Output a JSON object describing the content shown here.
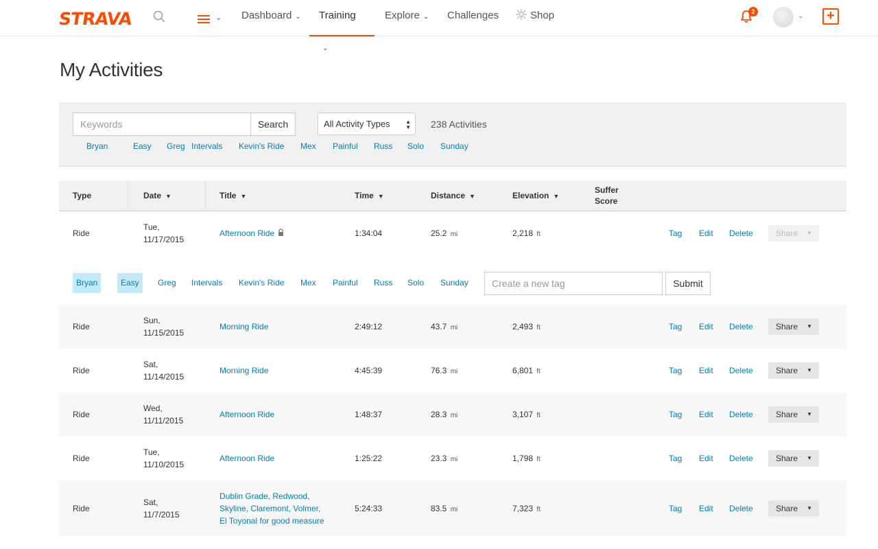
{
  "nav": {
    "logo": "STRAVA",
    "items": [
      {
        "label": "Dashboard",
        "has_menu": true
      },
      {
        "label": "Training",
        "has_menu": true,
        "active": true
      },
      {
        "label": "Explore",
        "has_menu": true
      },
      {
        "label": "Challenges",
        "has_menu": false
      },
      {
        "label": "Shop",
        "has_menu": false
      }
    ],
    "notification_count": "2",
    "accent_color": "#fc4c02",
    "icons": [
      "search-icon",
      "menu-icon",
      "shop-icon",
      "bell-icon",
      "avatar",
      "add-icon"
    ]
  },
  "page": {
    "title": "My Activities"
  },
  "filters": {
    "keyword_placeholder": "Keywords",
    "search_label": "Search",
    "activity_type": "All Activity Types",
    "count": "238 Activities",
    "tags": [
      "Bryan",
      "Easy",
      "Greg",
      "Intervals",
      "Kevin's Ride",
      "Mex",
      "Painful",
      "Russ",
      "Solo",
      "Sunday"
    ]
  },
  "table": {
    "columns": [
      {
        "label": "Type",
        "sortable": false
      },
      {
        "label": "Date",
        "sortable": true
      },
      {
        "label": "Title",
        "sortable": true
      },
      {
        "label": "Time",
        "sortable": true
      },
      {
        "label": "Distance",
        "sortable": true
      },
      {
        "label": "Elevation",
        "sortable": true
      },
      {
        "label": "Suffer Score",
        "sortable": false
      }
    ],
    "sort_glyph": "▼",
    "distance_unit": "mi",
    "elevation_unit": "ft",
    "actions": {
      "tag": "Tag",
      "edit": "Edit",
      "delete": "Delete",
      "share": "Share"
    },
    "rows": [
      {
        "type": "Ride",
        "day": "Tue,",
        "date": "11/17/2015",
        "title": "Afternoon Ride",
        "private": true,
        "time": "1:34:04",
        "distance": "25.2",
        "elevation": "2,218",
        "share_enabled": false
      },
      {
        "type": "Ride",
        "day": "Sun,",
        "date": "11/15/2015",
        "title": "Morning Ride",
        "time": "2:49:12",
        "distance": "43.7",
        "elevation": "2,493",
        "share_enabled": true
      },
      {
        "type": "Ride",
        "day": "Sat,",
        "date": "11/14/2015",
        "title": "Morning Ride",
        "time": "4:45:39",
        "distance": "76.3",
        "elevation": "6,801",
        "share_enabled": true
      },
      {
        "type": "Ride",
        "day": "Wed,",
        "date": "11/11/2015",
        "title": "Afternoon Ride",
        "time": "1:48:37",
        "distance": "28.3",
        "elevation": "3,107",
        "share_enabled": true
      },
      {
        "type": "Ride",
        "day": "Tue,",
        "date": "11/10/2015",
        "title": "Afternoon Ride",
        "time": "1:25:22",
        "distance": "23.3",
        "elevation": "1,798",
        "share_enabled": true
      },
      {
        "type": "Ride",
        "day": "Sat,",
        "date": "11/7/2015",
        "title_lines": [
          "Dublin Grade, Redwood,",
          "Skyline, Claremont, Volmer,",
          "El Toyonal for good measure"
        ],
        "time": "5:24:33",
        "distance": "83.5",
        "elevation": "7,323",
        "share_enabled": true
      }
    ]
  },
  "tag_editor": {
    "tags": [
      {
        "label": "Bryan",
        "selected": true
      },
      {
        "label": "Easy",
        "selected": true
      },
      {
        "label": "Greg",
        "selected": false
      },
      {
        "label": "Intervals",
        "selected": false
      },
      {
        "label": "Kevin's Ride",
        "selected": false
      },
      {
        "label": "Mex",
        "selected": false
      },
      {
        "label": "Painful",
        "selected": false
      },
      {
        "label": "Russ",
        "selected": false
      },
      {
        "label": "Solo",
        "selected": false
      },
      {
        "label": "Sunday",
        "selected": false
      }
    ],
    "new_tag_placeholder": "Create a new tag",
    "submit_label": "Submit"
  }
}
